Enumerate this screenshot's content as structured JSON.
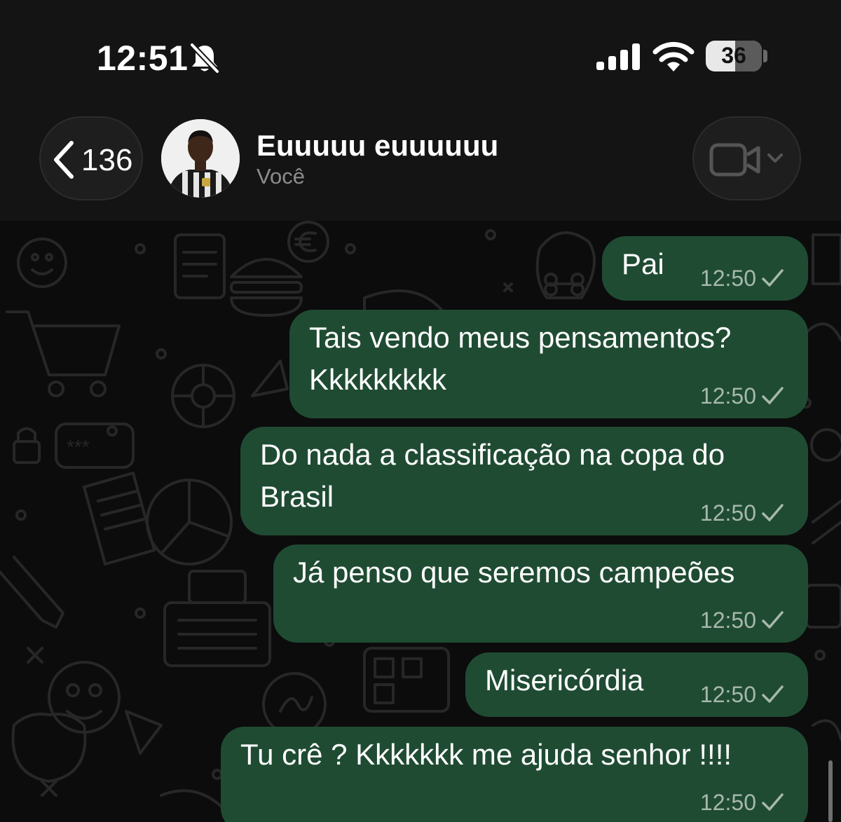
{
  "status_bar": {
    "time": "12:51",
    "battery": "36",
    "icons": [
      "bell-slash-icon",
      "cellular-signal-icon",
      "wifi-icon",
      "battery-icon"
    ]
  },
  "header": {
    "back_count": "136",
    "contact_name": "Euuuuu euuuuuu",
    "contact_subtitle": "Você",
    "icons": [
      "chevron-left-icon",
      "video-camera-icon",
      "chevron-down-icon"
    ]
  },
  "messages": [
    {
      "text_lines": [
        "Pai"
      ],
      "time": "12:50"
    },
    {
      "text_lines": [
        "Tais vendo meus pensamentos?",
        "Kkkkkkkkk"
      ],
      "time": "12:50"
    },
    {
      "text_lines": [
        "Do nada a classificação na copa do",
        "Brasil"
      ],
      "time": "12:50"
    },
    {
      "text_lines": [
        "Já penso que seremos campeões"
      ],
      "time": "12:50"
    },
    {
      "text_lines": [
        "Misericórdia"
      ],
      "time": "12:50"
    },
    {
      "text_lines": [
        "Tu crê ? Kkkkkkk me ajuda senhor !!!!"
      ],
      "time": "12:50"
    }
  ],
  "colors": {
    "bubble_outgoing": "#1f4b33",
    "header_background": "#141414",
    "chat_background": "#0c0c0c"
  }
}
